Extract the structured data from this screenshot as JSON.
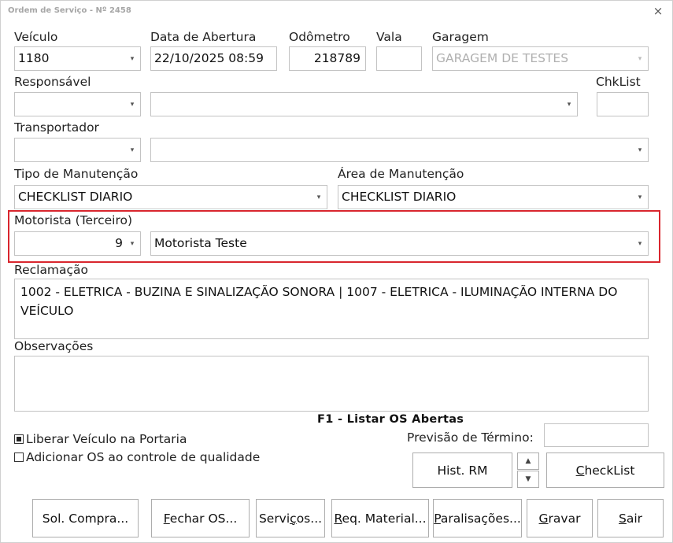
{
  "window": {
    "title": "Ordem de Serviço - Nº 2458",
    "close_glyph": "×"
  },
  "veiculo": {
    "label": "Veículo",
    "value": "1180"
  },
  "data_abertura": {
    "label": "Data de Abertura",
    "value": "22/10/2025 08:59"
  },
  "odometro": {
    "label": "Odômetro",
    "value": "218789"
  },
  "vala": {
    "label": "Vala",
    "value": ""
  },
  "garagem": {
    "label": "Garagem",
    "value": "GARAGEM DE TESTES"
  },
  "responsavel": {
    "label": "Responsável",
    "code": "",
    "name": ""
  },
  "chklist": {
    "label": "ChkList",
    "value": ""
  },
  "transportador": {
    "label": "Transportador",
    "code": "",
    "name": ""
  },
  "tipo_manutencao": {
    "label": "Tipo de Manutenção",
    "value": "CHECKLIST DIARIO"
  },
  "area_manutencao": {
    "label": "Área de Manutenção",
    "value": "CHECKLIST DIARIO"
  },
  "motorista": {
    "label": "Motorista (Terceiro)",
    "code": "9",
    "name": "Motorista Teste"
  },
  "reclamacao": {
    "label": "Reclamação",
    "text": "1002 - ELETRICA - BUZINA E SINALIZAÇÃO SONORA | 1007 - ELETRICA - ILUMINAÇÃO INTERNA DO VEÍCULO"
  },
  "observacoes": {
    "label": "Observações",
    "text": ""
  },
  "hint": "F1 - Listar OS Abertas",
  "options": {
    "liberar": {
      "label": "Liberar Veículo na Portaria",
      "checked": true
    },
    "qualidade": {
      "label": "Adicionar OS ao controle de qualidade",
      "checked": false
    }
  },
  "previsao": {
    "label": "Previsão de Término:",
    "value": ""
  },
  "buttons": {
    "hist_rm": "Hist. RM",
    "checklist": {
      "mnemonic": "C",
      "rest": "heckList"
    },
    "sol_compra": "Sol. Compra...",
    "fechar_os": {
      "mnemonic": "F",
      "rest": "echar OS..."
    },
    "servicos": {
      "pre": "Servi",
      "mnemonic": "ç",
      "rest": "os..."
    },
    "req_material": {
      "mnemonic": "R",
      "rest": "eq. Material..."
    },
    "paralisacoes": {
      "mnemonic": "P",
      "rest": "aralisações..."
    },
    "gravar": {
      "mnemonic": "G",
      "rest": "ravar"
    },
    "sair": {
      "mnemonic": "S",
      "rest": "air"
    }
  },
  "icons": {
    "dropdown": "chevron-down-icon",
    "spin_up": "chevron-up-icon",
    "spin_down": "chevron-down-icon"
  }
}
